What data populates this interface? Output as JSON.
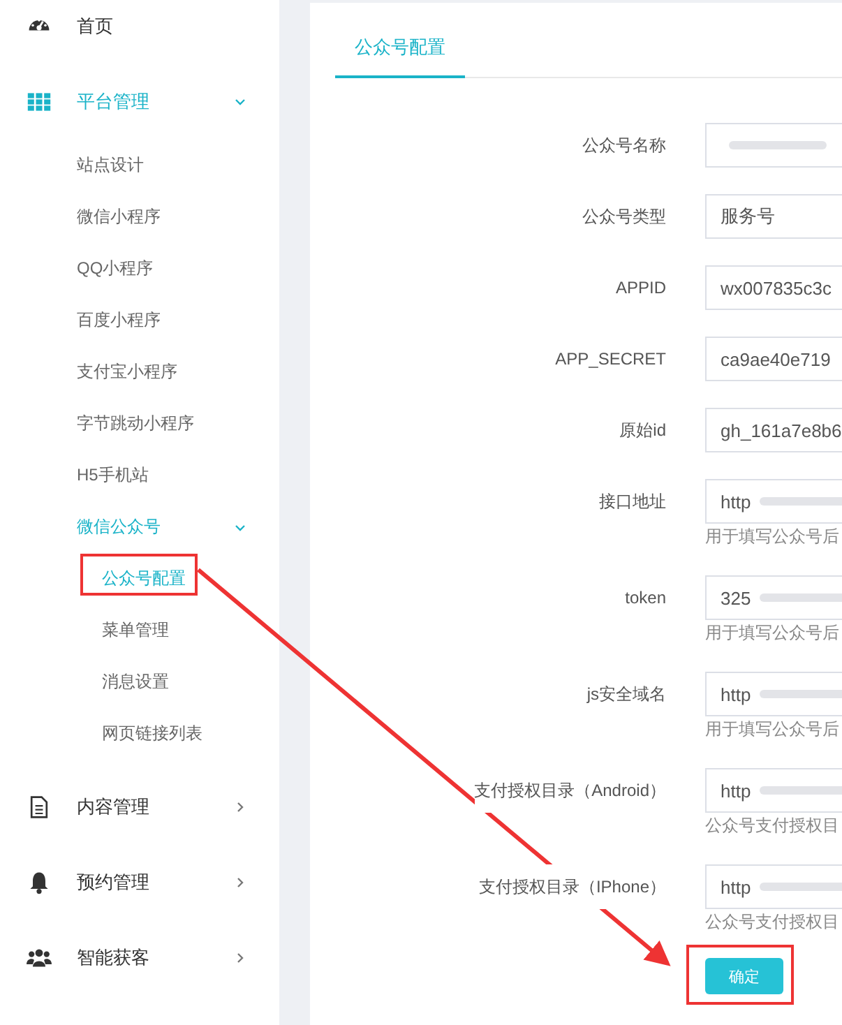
{
  "sidebar": {
    "items": [
      {
        "label": "首页",
        "selected": false
      },
      {
        "label": "平台管理",
        "expanded": true,
        "selected": true,
        "children": [
          {
            "label": "站点设计",
            "selected": false
          },
          {
            "label": "微信小程序",
            "selected": false
          },
          {
            "label": "QQ小程序",
            "selected": false
          },
          {
            "label": "百度小程序",
            "selected": false
          },
          {
            "label": "支付宝小程序",
            "selected": false
          },
          {
            "label": "字节跳动小程序",
            "selected": false
          },
          {
            "label": "H5手机站",
            "selected": false
          },
          {
            "label": "微信公众号",
            "selected": true,
            "expanded": true,
            "children": [
              {
                "label": "公众号配置",
                "selected": true
              },
              {
                "label": "菜单管理",
                "selected": false
              },
              {
                "label": "消息设置",
                "selected": false
              },
              {
                "label": "网页链接列表",
                "selected": false
              }
            ]
          }
        ]
      },
      {
        "label": "内容管理",
        "expanded": false,
        "selected": false
      },
      {
        "label": "预约管理",
        "expanded": false,
        "selected": false
      },
      {
        "label": "智能获客",
        "expanded": false,
        "selected": false
      }
    ]
  },
  "tabs": [
    {
      "label": "公众号配置",
      "selected": true
    }
  ],
  "form": {
    "fields": [
      {
        "label": "公众号名称",
        "redacted": true
      },
      {
        "label": "公众号类型",
        "value": "服务号"
      },
      {
        "label": "APPID",
        "value": "wx007835c3c"
      },
      {
        "label": "APP_SECRET",
        "value": "ca9ae40e719"
      },
      {
        "label": "原始id",
        "value": "gh_161a7e8b6"
      },
      {
        "label": "接口地址",
        "value": "http",
        "redacted": true,
        "help": "用于填写公众号后"
      },
      {
        "label": "token",
        "value": "325",
        "redacted": true,
        "help": "用于填写公众号后"
      },
      {
        "label": "js安全域名",
        "value": "http",
        "redacted": true,
        "help": "用于填写公众号后"
      },
      {
        "label": "支付授权目录（Android）",
        "value": "http",
        "redacted": true,
        "help": "公众号支付授权目"
      },
      {
        "label": "支付授权目录（IPhone）",
        "value": "http",
        "redacted": true,
        "help": "公众号支付授权目"
      }
    ],
    "submit": "确定"
  }
}
